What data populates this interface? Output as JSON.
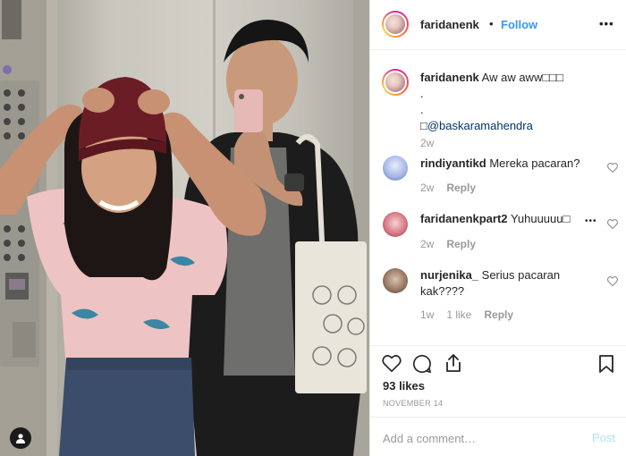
{
  "header": {
    "username": "faridanenk",
    "separator": "•",
    "follow_label": "Follow",
    "more_label": "•••"
  },
  "caption": {
    "username": "faridanenk",
    "text": "Aw aw aww□□□",
    "line2": ".",
    "line3": ".",
    "line4_prefix": "□",
    "mention": "@baskaramahendra",
    "time": "2w"
  },
  "comments": [
    {
      "username": "rindiyantikd",
      "text": "Mereka pacaran?",
      "time": "2w",
      "likes": "",
      "reply_label": "Reply"
    },
    {
      "username": "faridanenkpart2",
      "text": "Yuhuuuuu□",
      "time": "2w",
      "likes": "",
      "reply_label": "Reply"
    },
    {
      "username": "nurjenika_",
      "text": "Serius pacaran kak????",
      "time": "1w",
      "likes": "1 like",
      "reply_label": "Reply"
    }
  ],
  "actions": {
    "likes_text": "93 likes",
    "date": "NOVEMBER 14"
  },
  "add_comment": {
    "placeholder": "Add a comment…",
    "post_label": "Post"
  },
  "colors": {
    "link": "#3897f0",
    "text": "#262626",
    "muted": "#999999",
    "post_disabled": "#b2dffc"
  },
  "icons": [
    "heart-icon",
    "comment-icon",
    "share-icon",
    "bookmark-icon",
    "more-icon",
    "user-tag-icon"
  ]
}
